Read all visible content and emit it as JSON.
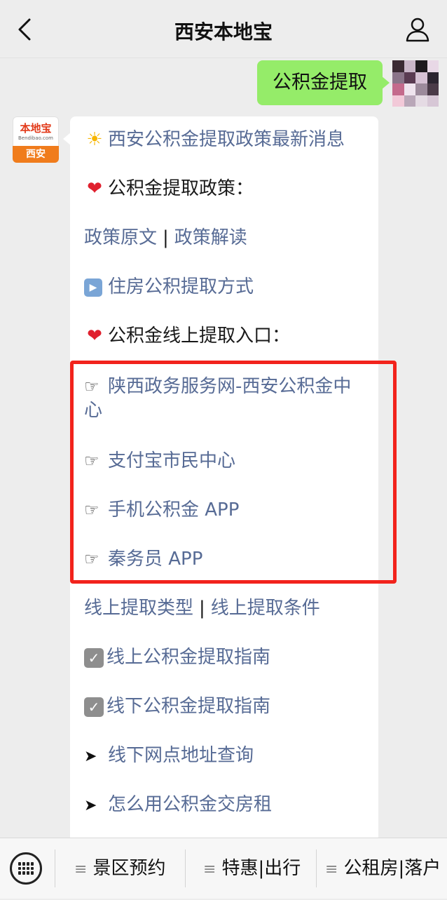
{
  "header": {
    "title": "西安本地宝"
  },
  "chat": {
    "user_message": "公积金提取",
    "bot_avatar": {
      "logo_text": "本地宝",
      "logo_url": "Bendibao.com",
      "city": "西安"
    },
    "reply": {
      "headline": "西安公积金提取政策最新消息",
      "policy_heading": "公积金提取政策：",
      "policy_original": "政策原文",
      "separator": "|",
      "policy_interpret": "政策解读",
      "withdraw_methods": "住房公积提取方式",
      "online_entry_heading": "公积金线上提取入口：",
      "entry_shaanxi_line1": "陕西政务服务网-西安公积金中",
      "entry_shaanxi_line2": "心",
      "entry_alipay": "支付宝市民中心",
      "entry_mobile_app": "手机公积金 APP",
      "entry_qinwuyuan": "秦务员 APP",
      "online_types": "线上提取类型",
      "online_conditions": "线上提取条件",
      "online_guide": "线上公积金提取指南",
      "offline_guide": "线下公积金提取指南",
      "offline_address": "线下网点地址查询",
      "rent_payment": "怎么用公积金交房租"
    }
  },
  "bottom_menu": {
    "items": [
      {
        "label": "景区预约"
      },
      {
        "label": "特惠|出行"
      },
      {
        "label": "公租房|落户"
      }
    ]
  },
  "icons": {
    "back": "chevron-left-icon",
    "profile": "person-icon",
    "keyboard": "keyboard-icon"
  },
  "colors": {
    "link": "#576b95",
    "highlight": "#f2231c",
    "outgoing_bubble": "#95ec69",
    "background": "#ededed"
  }
}
